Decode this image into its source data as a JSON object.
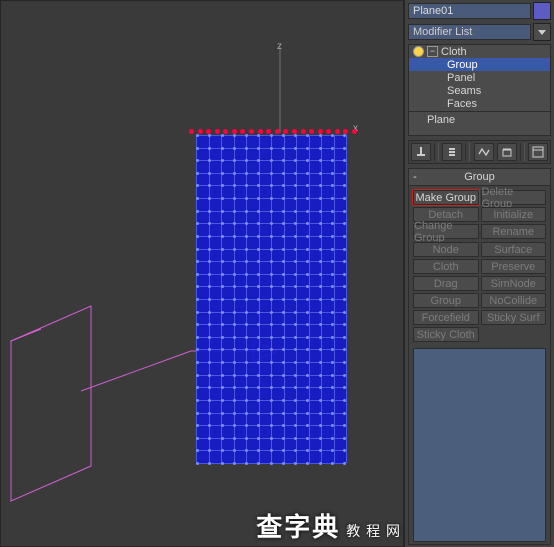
{
  "viewport": {
    "axis_z": "z",
    "axis_x": "x",
    "watermark_cn": "查字典",
    "watermark_en": "教 程 网"
  },
  "panel": {
    "object_name": "Plane01",
    "object_color": "#5c5cc4",
    "modifier_dropdown": "Modifier List",
    "stack": {
      "modifier": "Cloth",
      "subs": [
        "Group",
        "Panel",
        "Seams",
        "Faces"
      ],
      "selected_sub_index": 0,
      "base": "Plane"
    },
    "toolbar_icons": [
      "pin-icon",
      "stack-icon",
      "show-end-icon",
      "make-unique-icon",
      "remove-icon",
      "configure-icon"
    ],
    "rollout_title": "Group",
    "buttons": {
      "make_group": {
        "label": "Make Group",
        "enabled": true,
        "highlight": true
      },
      "delete_group": {
        "label": "Delete Group",
        "enabled": false
      },
      "detach": {
        "label": "Detach",
        "enabled": false
      },
      "initialize": {
        "label": "Initialize",
        "enabled": false
      },
      "change_group": {
        "label": "Change Group",
        "enabled": false
      },
      "rename": {
        "label": "Rename",
        "enabled": false
      },
      "node": {
        "label": "Node",
        "enabled": false
      },
      "surface": {
        "label": "Surface",
        "enabled": false
      },
      "cloth": {
        "label": "Cloth",
        "enabled": false
      },
      "preserve": {
        "label": "Preserve",
        "enabled": false
      },
      "drag": {
        "label": "Drag",
        "enabled": false
      },
      "simnode": {
        "label": "SimNode",
        "enabled": false
      },
      "group": {
        "label": "Group",
        "enabled": false
      },
      "nocollide": {
        "label": "NoCollide",
        "enabled": false
      },
      "forcefield": {
        "label": "Forcefield",
        "enabled": false
      },
      "sticky_surf": {
        "label": "Sticky Surf",
        "enabled": false
      },
      "sticky_cloth": {
        "label": "Sticky Cloth",
        "enabled": false
      }
    }
  },
  "colors": {
    "panel_bg": "#414141",
    "viewport_bg": "#3a3a3a",
    "selection_red": "#ff0040",
    "cloth_face": "#151bcd",
    "stack_sel": "#3858a8"
  }
}
